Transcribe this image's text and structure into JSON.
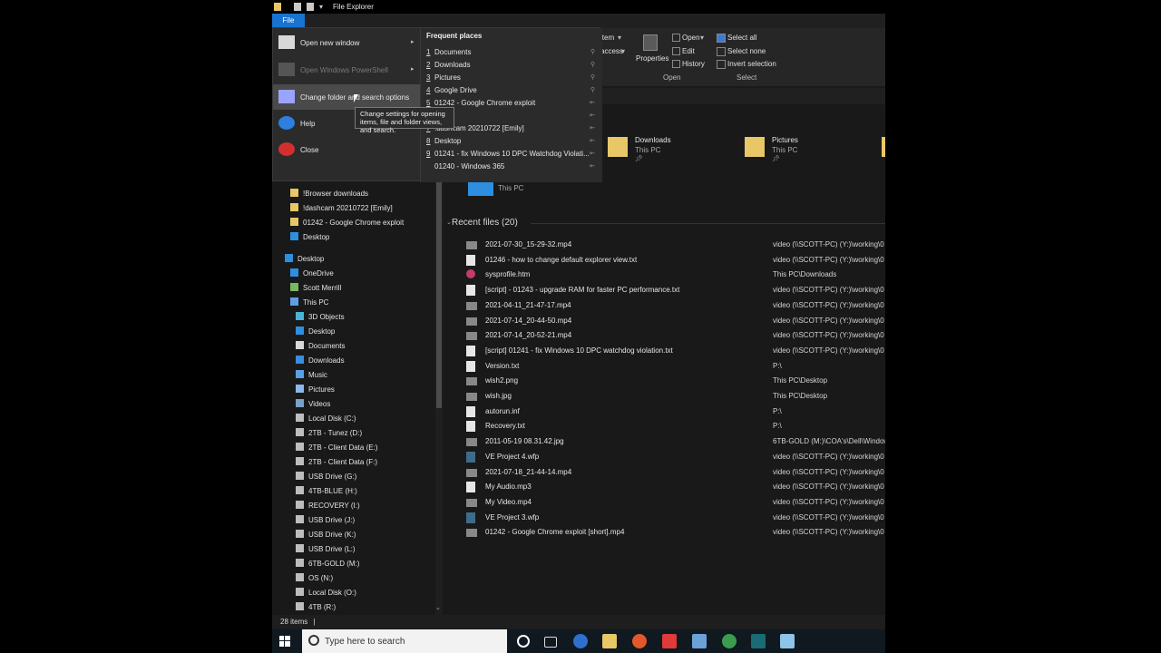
{
  "window": {
    "title": "File Explorer",
    "file_tab": "File"
  },
  "ribbon": {
    "item_partial": "item",
    "access_partial": "access",
    "properties": "Properties",
    "open": "Open",
    "edit": "Edit",
    "history": "History",
    "select_all": "Select all",
    "select_none": "Select none",
    "invert_selection": "Invert selection",
    "group_open": "Open",
    "group_select": "Select"
  },
  "file_menu": {
    "items": [
      {
        "label": "Open new window",
        "enabled": true
      },
      {
        "label": "Open Windows PowerShell",
        "enabled": false
      },
      {
        "label": "Change folder and search options",
        "enabled": true
      },
      {
        "label": "Help",
        "enabled": true
      },
      {
        "label": "Close",
        "enabled": true
      }
    ],
    "frequent_title": "Frequent places",
    "frequent": [
      {
        "n": "1",
        "label": "Documents"
      },
      {
        "n": "2",
        "label": "Downloads"
      },
      {
        "n": "3",
        "label": "Pictures"
      },
      {
        "n": "4",
        "label": "Google Drive"
      },
      {
        "n": "5",
        "label": "01242 - Google Chrome exploit"
      },
      {
        "n": "6",
        "label": "oads"
      },
      {
        "n": "7",
        "label": "!dashcam 20210722 [Emily]"
      },
      {
        "n": "8",
        "label": "Desktop"
      },
      {
        "n": "9",
        "label": "01241 - fix Windows 10 DPC Watchdog Violati..."
      },
      {
        "n": "",
        "label": "01240 - Windows 365"
      }
    ],
    "tooltip": "Change settings for opening items, file and folder views, and search."
  },
  "quick_access_tiles": [
    {
      "name": "Downloads",
      "sub": "This PC"
    },
    {
      "name": "Pictures",
      "sub": "This PC"
    },
    {
      "name": "",
      "sub": "This PC"
    }
  ],
  "nav": {
    "items": [
      {
        "label": "!Browser downloads",
        "indent": 1,
        "icon": "folder"
      },
      {
        "label": "!dashcam 20210722 [Emily]",
        "indent": 1,
        "icon": "folder"
      },
      {
        "label": "01242 - Google Chrome exploit",
        "indent": 1,
        "icon": "folder"
      },
      {
        "label": "Desktop",
        "indent": 1,
        "icon": "desktop"
      },
      {
        "label": "Desktop",
        "indent": 0,
        "icon": "desktop"
      },
      {
        "label": "OneDrive",
        "indent": 1,
        "icon": "cloud"
      },
      {
        "label": "Scott Merrill",
        "indent": 1,
        "icon": "user"
      },
      {
        "label": "This PC",
        "indent": 1,
        "icon": "pc"
      },
      {
        "label": "3D Objects",
        "indent": 2,
        "icon": "cube"
      },
      {
        "label": "Desktop",
        "indent": 2,
        "icon": "desktop"
      },
      {
        "label": "Documents",
        "indent": 2,
        "icon": "doc"
      },
      {
        "label": "Downloads",
        "indent": 2,
        "icon": "download"
      },
      {
        "label": "Music",
        "indent": 2,
        "icon": "music"
      },
      {
        "label": "Pictures",
        "indent": 2,
        "icon": "picture"
      },
      {
        "label": "Videos",
        "indent": 2,
        "icon": "video"
      },
      {
        "label": "Local Disk (C:)",
        "indent": 2,
        "icon": "drive"
      },
      {
        "label": "2TB - Tunez (D:)",
        "indent": 2,
        "icon": "drive"
      },
      {
        "label": "2TB - Client Data (E:)",
        "indent": 2,
        "icon": "drive"
      },
      {
        "label": "2TB - Client Data (F:)",
        "indent": 2,
        "icon": "drive"
      },
      {
        "label": "USB Drive (G:)",
        "indent": 2,
        "icon": "usb"
      },
      {
        "label": "4TB-BLUE (H:)",
        "indent": 2,
        "icon": "drive"
      },
      {
        "label": "RECOVERY (I:)",
        "indent": 2,
        "icon": "drive"
      },
      {
        "label": "USB Drive (J:)",
        "indent": 2,
        "icon": "usb"
      },
      {
        "label": "USB Drive (K:)",
        "indent": 2,
        "icon": "usb"
      },
      {
        "label": "USB Drive (L:)",
        "indent": 2,
        "icon": "usb"
      },
      {
        "label": "6TB-GOLD (M:)",
        "indent": 2,
        "icon": "drive"
      },
      {
        "label": "OS (N:)",
        "indent": 2,
        "icon": "drive"
      },
      {
        "label": "Local Disk (O:)",
        "indent": 2,
        "icon": "drive"
      },
      {
        "label": "4TB (R:)",
        "indent": 2,
        "icon": "drive"
      }
    ]
  },
  "recent": {
    "heading": "Recent files (20)",
    "files": [
      {
        "name": "2021-07-30_15-29-32.mp4",
        "location": "video (\\\\SCOTT-PC) (Y:)\\working\\0"
      },
      {
        "name": "01246 - how to change default explorer view.txt",
        "location": "video (\\\\SCOTT-PC) (Y:)\\working\\0"
      },
      {
        "name": "sysprofile.htm",
        "location": "This PC\\Downloads"
      },
      {
        "name": "[script] - 01243 - upgrade RAM for faster PC performance.txt",
        "location": "video (\\\\SCOTT-PC) (Y:)\\working\\0"
      },
      {
        "name": "2021-04-11_21-47-17.mp4",
        "location": "video (\\\\SCOTT-PC) (Y:)\\working\\0"
      },
      {
        "name": "2021-07-14_20-44-50.mp4",
        "location": "video (\\\\SCOTT-PC) (Y:)\\working\\0"
      },
      {
        "name": "2021-07-14_20-52-21.mp4",
        "location": "video (\\\\SCOTT-PC) (Y:)\\working\\0"
      },
      {
        "name": "[script] 01241 - fix Windows 10 DPC watchdog violation.txt",
        "location": "video (\\\\SCOTT-PC) (Y:)\\working\\0"
      },
      {
        "name": "Version.txt",
        "location": "P:\\"
      },
      {
        "name": "wish2.png",
        "location": "This PC\\Desktop"
      },
      {
        "name": "wish.jpg",
        "location": "This PC\\Desktop"
      },
      {
        "name": "autorun.inf",
        "location": "P:\\"
      },
      {
        "name": "Recovery.txt",
        "location": "P:\\"
      },
      {
        "name": "2011-05-19 08.31.42.jpg",
        "location": "6TB-GOLD (M:)\\COA's\\Dell\\Window"
      },
      {
        "name": "VE Project 4.wfp",
        "location": "video (\\\\SCOTT-PC) (Y:)\\working\\0"
      },
      {
        "name": "2021-07-18_21-44-14.mp4",
        "location": "video (\\\\SCOTT-PC) (Y:)\\working\\0"
      },
      {
        "name": "My Audio.mp3",
        "location": "video (\\\\SCOTT-PC) (Y:)\\working\\0"
      },
      {
        "name": "My Video.mp4",
        "location": "video (\\\\SCOTT-PC) (Y:)\\working\\0"
      },
      {
        "name": "VE Project 3.wfp",
        "location": "video (\\\\SCOTT-PC) (Y:)\\working\\0"
      },
      {
        "name": "01242 - Google Chrome exploit [short].mp4",
        "location": "video (\\\\SCOTT-PC) (Y:)\\working\\0"
      }
    ]
  },
  "status": {
    "items": "28 items",
    "sep": "|"
  },
  "taskbar": {
    "search_placeholder": "Type here to search"
  },
  "colors": {
    "accent": "#1973d0",
    "folder": "#e8c766",
    "window_bg": "#191919"
  }
}
